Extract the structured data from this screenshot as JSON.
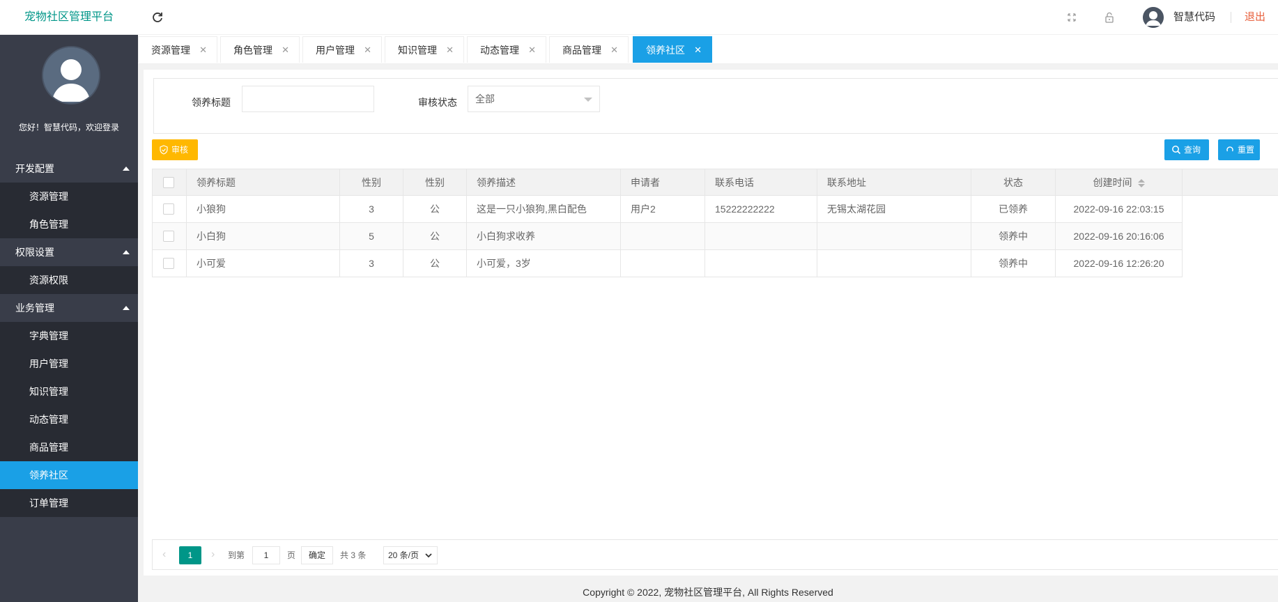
{
  "header": {
    "app_title": "宠物社区管理平台",
    "username": "智慧代码",
    "logout_label": "退出"
  },
  "sidebar": {
    "welcome": "您好！智慧代码，欢迎登录",
    "groups": [
      {
        "label": "开发配置",
        "items": [
          "资源管理",
          "角色管理"
        ]
      },
      {
        "label": "权限设置",
        "items": [
          "资源权限"
        ]
      },
      {
        "label": "业务管理",
        "items": [
          "字典管理",
          "用户管理",
          "知识管理",
          "动态管理",
          "商品管理",
          "领养社区",
          "订单管理"
        ]
      }
    ],
    "active_item": "领养社区"
  },
  "tabs": [
    {
      "label": "资源管理"
    },
    {
      "label": "角色管理"
    },
    {
      "label": "用户管理"
    },
    {
      "label": "知识管理"
    },
    {
      "label": "动态管理"
    },
    {
      "label": "商品管理"
    },
    {
      "label": "领养社区",
      "active": true
    }
  ],
  "search": {
    "title_label": "领养标题",
    "title_value": "",
    "status_label": "审核状态",
    "status_value": "全部"
  },
  "toolbar": {
    "audit_label": "审核",
    "query_label": "查询",
    "reset_label": "重置"
  },
  "table": {
    "columns": [
      "领养标题",
      "性别",
      "性别",
      "领养描述",
      "申请者",
      "联系电话",
      "联系地址",
      "状态",
      "创建时间"
    ],
    "rows": [
      [
        "小狼狗",
        "3",
        "公",
        "这是一只小狼狗,黑白配色",
        "用户2",
        "15222222222",
        "无锡太湖花园",
        "已领养",
        "2022-09-16 22:03:15"
      ],
      [
        "小白狗",
        "5",
        "公",
        "小白狗求收养",
        "",
        "",
        "",
        "领养中",
        "2022-09-16 20:16:06"
      ],
      [
        "小可爱",
        "3",
        "公",
        "小可爱，3岁",
        "",
        "",
        "",
        "领养中",
        "2022-09-16 12:26:20"
      ]
    ]
  },
  "pager": {
    "current": "1",
    "goto_label": "到第",
    "goto_value": "1",
    "page_unit": "页",
    "confirm_label": "确定",
    "total_label": "共 3 条",
    "page_size": "20 条/页"
  },
  "footer": {
    "copyright": "Copyright © 2022, 宠物社区管理平台, All Rights Reserved"
  },
  "colors": {
    "accent": "#1aa0e6",
    "brand": "#009688",
    "warning": "#ffb800",
    "sidebar": "#393d49",
    "logout": "#e8603c"
  }
}
